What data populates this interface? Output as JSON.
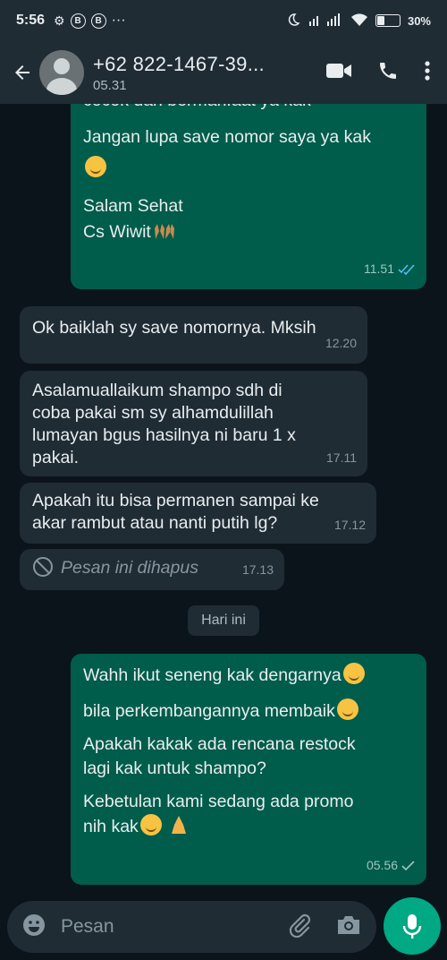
{
  "status_bar": {
    "time": "5:56",
    "notif_icons": [
      "B",
      "B"
    ],
    "more": "···",
    "battery": "30%",
    "battery_level": 0.3
  },
  "header": {
    "contact_name": "+62 822-1467-39...",
    "subtitle": "05.31"
  },
  "messages": [
    {
      "direction": "out",
      "lines": [
        "cocok dan bermanfaat ya kak",
        "",
        "Jangan lupa save nomor saya ya kak",
        "",
        "",
        "Salam Sehat",
        "Cs Wiwit"
      ],
      "time": "11.51",
      "status": "read"
    },
    {
      "direction": "in",
      "lines": [
        "Ok baiklah sy save nomornya. Mksih"
      ],
      "time": "12.20"
    },
    {
      "direction": "in",
      "lines": [
        "Asalamuallaikum shampo sdh di",
        "coba pakai sm sy alhamdulillah",
        "lumayan bgus hasilnya ni baru 1 x",
        "pakai."
      ],
      "time": "17.11"
    },
    {
      "direction": "in",
      "lines": [
        "Apakah itu bisa  permanen sampai ke",
        "akar rambut atau nanti putih lg?"
      ],
      "time": "17.12"
    },
    {
      "direction": "in",
      "deleted": true,
      "lines": [
        "Pesan ini dihapus"
      ],
      "time": "17.13"
    },
    {
      "direction": "out",
      "lines": [
        "Wahh ikut seneng kak dengarnya",
        "bila perkembangannya membaik",
        "",
        "Apakah kakak ada rencana restock",
        "lagi kak untuk shampo?",
        "",
        "Kebetulan kami sedang ada promo",
        "nih kak"
      ],
      "time": "05.56",
      "status": "sent"
    }
  ],
  "date_separator": "Hari ini",
  "composer": {
    "placeholder": "Pesan"
  },
  "colors": {
    "background": "#0b141a",
    "bar": "#1f2c34",
    "outgoing": "#005c4b",
    "incoming": "#1f2c34",
    "accent": "#00a884",
    "read_tick": "#53bdeb"
  },
  "icons": [
    "back-arrow-icon",
    "video-call-icon",
    "phone-icon",
    "more-vert-icon",
    "emoji-icon",
    "attach-icon",
    "camera-icon",
    "mic-icon",
    "blocked-icon"
  ]
}
